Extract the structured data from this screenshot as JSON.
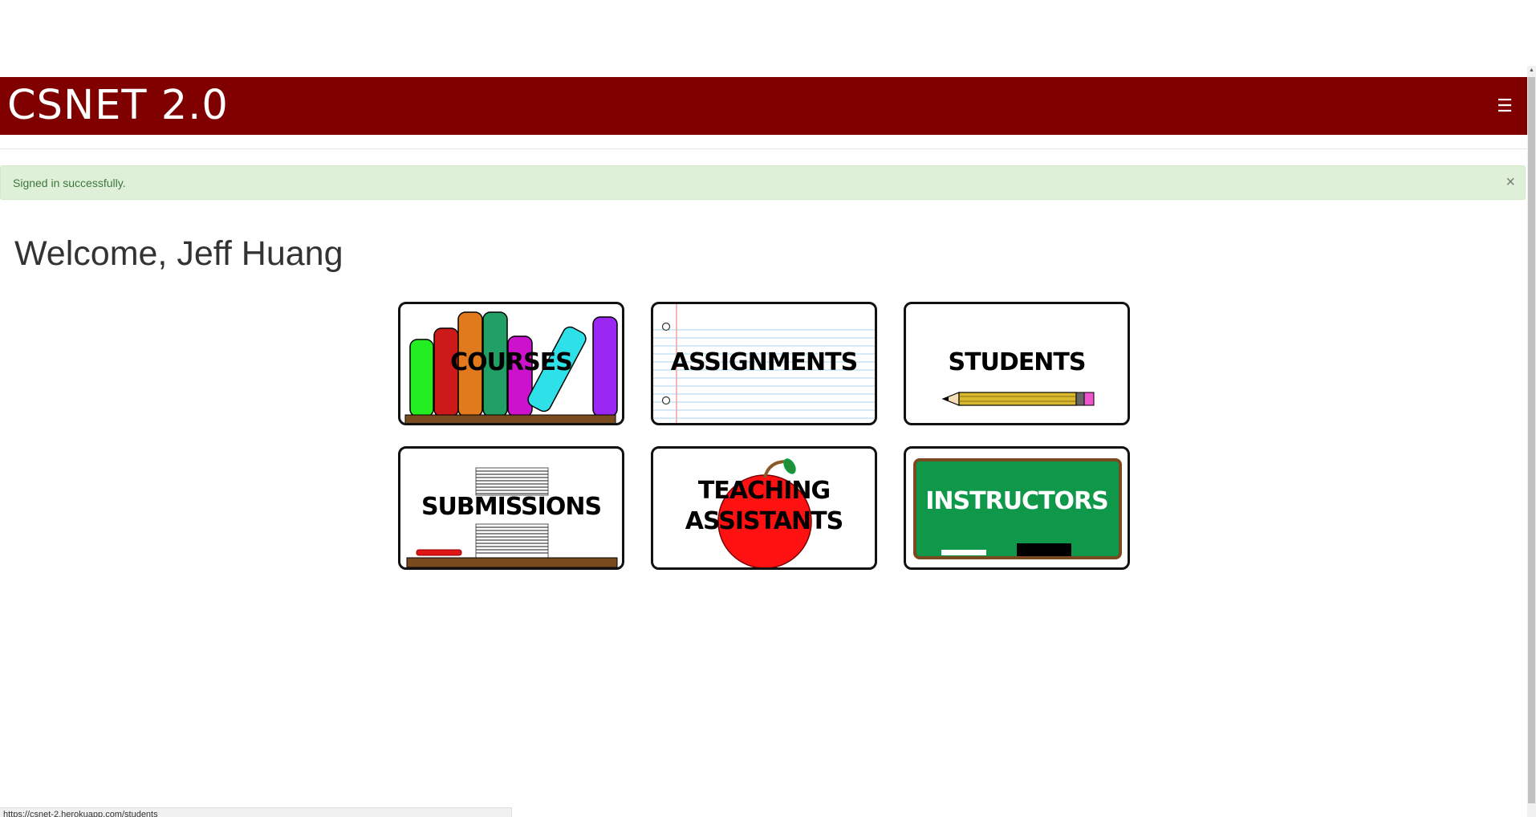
{
  "navbar": {
    "brand": "CSNET 2.0",
    "menu_icon": "hamburger-icon",
    "color": "#800000"
  },
  "alert": {
    "message": "Signed in successfully.",
    "close_symbol": "×"
  },
  "welcome": "Welcome, Jeff Huang",
  "tiles": [
    {
      "label": "COURSES"
    },
    {
      "label": "ASSIGNMENTS"
    },
    {
      "label": "STUDENTS"
    },
    {
      "label": "SUBMISSIONS"
    },
    {
      "label_line1": "TEACHING",
      "label_line2": "ASSISTANTS"
    },
    {
      "label": "INSTRUCTORS"
    }
  ],
  "status_bar": {
    "url": "https://csnet-2.herokuapp.com/students"
  }
}
